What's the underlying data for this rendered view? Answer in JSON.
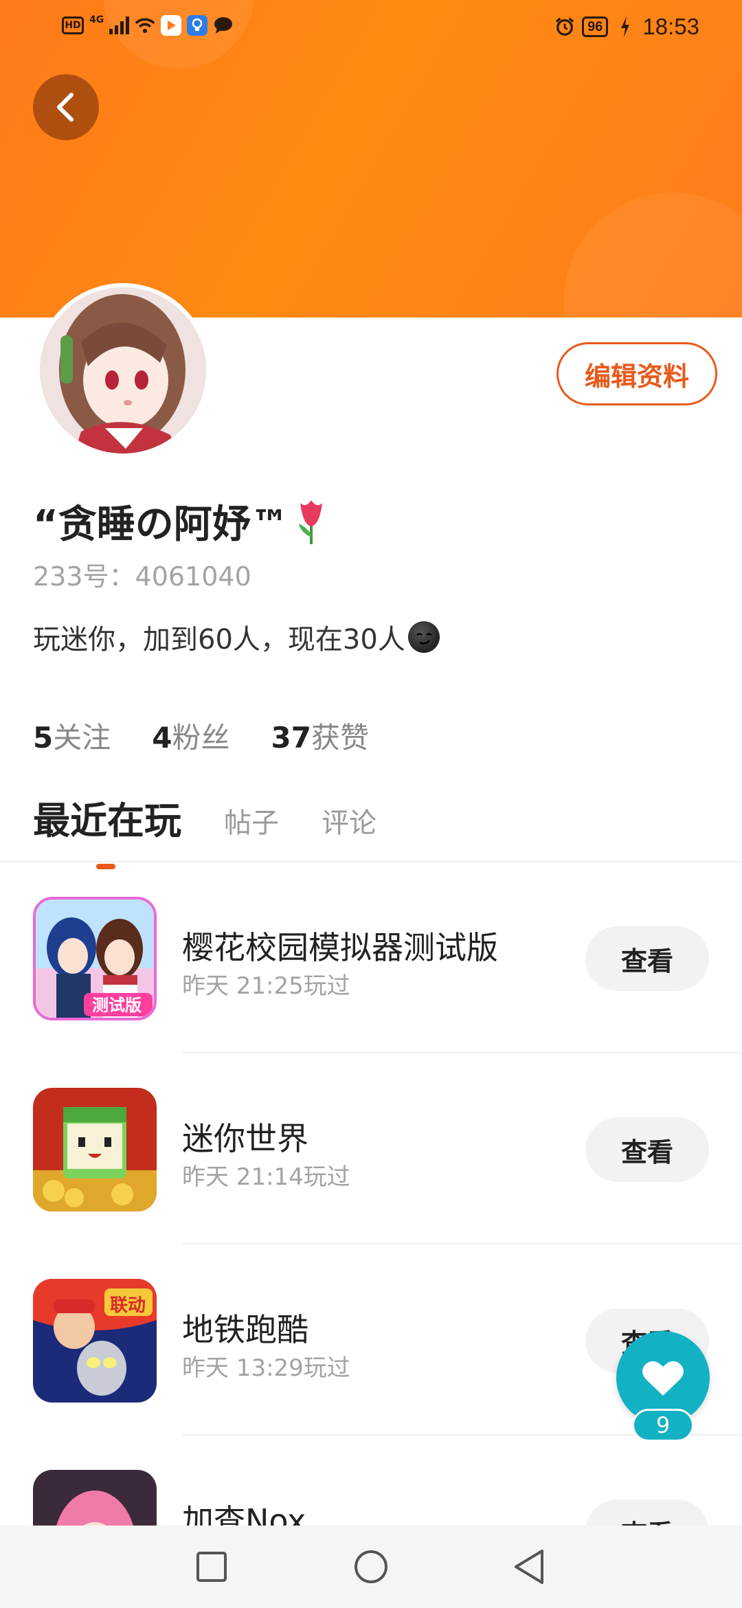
{
  "status_bar": {
    "hd": "HD",
    "network": "4G",
    "battery": "96",
    "time": "18:53"
  },
  "profile": {
    "nickname": "“贪睡の阿妤™",
    "uid": "233号：4061040",
    "bio": "玩迷你，加到60人，现在30人",
    "edit_button": "编辑资料"
  },
  "stats": [
    {
      "count": "5",
      "label": "关注"
    },
    {
      "count": "4",
      "label": "粉丝"
    },
    {
      "count": "37",
      "label": "获赞"
    }
  ],
  "tabs": [
    "最近在玩",
    "帖子",
    "评论"
  ],
  "games": [
    {
      "title": "樱花校园模拟器测试版",
      "time": "昨天 21:25玩过",
      "button": "查看",
      "badge": "测试版"
    },
    {
      "title": "迷你世界",
      "time": "昨天 21:14玩过",
      "button": "查看"
    },
    {
      "title": "地铁跑酷",
      "time": "昨天 13:29玩过",
      "button": "查看",
      "badge": "联动"
    },
    {
      "title": "加查Nox",
      "time": "",
      "button": "查看"
    }
  ],
  "fab": {
    "count": "9"
  },
  "colors": {
    "accent": "#e8591a",
    "banner": "#ff8014",
    "fab": "#12b1c4"
  }
}
